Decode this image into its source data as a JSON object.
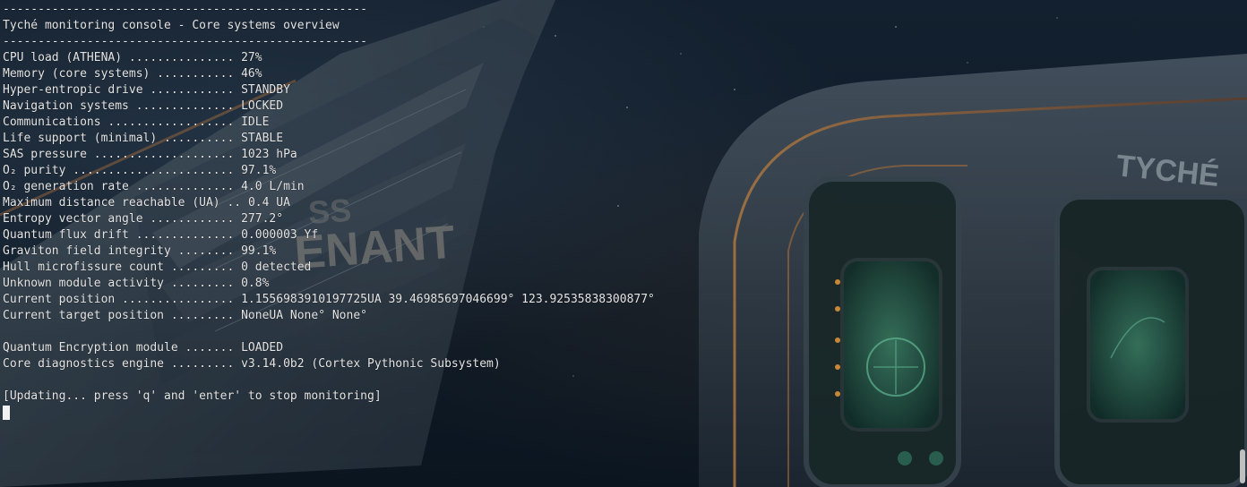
{
  "terminal": {
    "separator_top": "----------------------------------------------------",
    "title": "Tyché monitoring console - Core systems overview",
    "separator_bottom": "----------------------------------------------------",
    "rows": [
      {
        "label": "CPU load (ATHENA) ...............",
        "value": "27%"
      },
      {
        "label": "Memory (core systems) ...........",
        "value": "46%"
      },
      {
        "label": "Hyper-entropic drive ............",
        "value": "STANDBY"
      },
      {
        "label": "Navigation systems ..............",
        "value": "LOCKED"
      },
      {
        "label": "Communications ..................",
        "value": "IDLE"
      },
      {
        "label": "Life support (minimal) ..........",
        "value": "STABLE"
      },
      {
        "label": "SAS pressure ....................",
        "value": "1023 hPa"
      },
      {
        "label": "O₂ purity .......................",
        "value": "97.1%"
      },
      {
        "label": "O₂ generation rate ..............",
        "value": "4.0 L/min"
      },
      {
        "label": "Maximum distance reachable (UA) ..",
        "value": "0.4 UA"
      },
      {
        "label": "Entropy vector angle ............",
        "value": "277.2°"
      },
      {
        "label": "Quantum flux drift ..............",
        "value": "0.000003 Yf"
      },
      {
        "label": "Graviton field integrity ........",
        "value": "99.1%"
      },
      {
        "label": "Hull microfissure count .........",
        "value": "0 detected"
      },
      {
        "label": "Unknown module activity .........",
        "value": "0.8%"
      },
      {
        "label": "Current position ................",
        "value": "1.1556983910197725UA 39.46985697046699° 123.92535838300877°"
      },
      {
        "label": "Current target position .........",
        "value": "NoneUA None° None°"
      }
    ],
    "modules": [
      {
        "label": "Quantum Encryption module .......",
        "value": "LOADED"
      },
      {
        "label": "Core diagnostics engine .........",
        "value": "v3.14.0b2 (Cortex Pythonic Subsystem)"
      }
    ],
    "prompt": "[Updating... press 'q' and 'enter' to stop monitoring]"
  },
  "wallpaper": {
    "hull_text_1": "TYCHÉ",
    "hull_text_2": "ENANT",
    "hull_text_3": "SS"
  },
  "colors": {
    "text": "#e6e6e6",
    "background": "#0e1a27",
    "screen_glow": "#3fa888",
    "hull_orange": "#c07a3e"
  }
}
